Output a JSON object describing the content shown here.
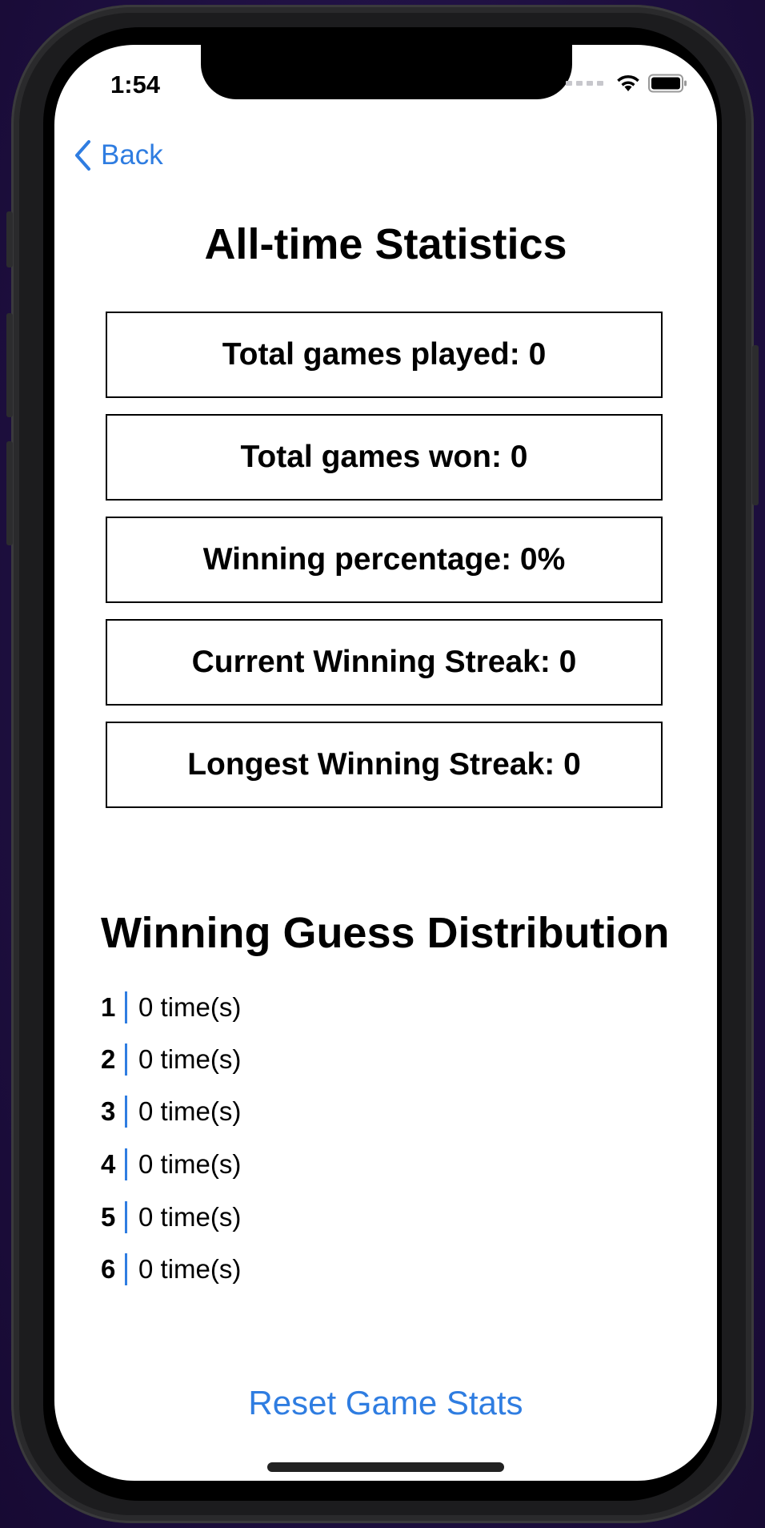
{
  "status_bar": {
    "time": "1:54"
  },
  "nav": {
    "back_label": "Back"
  },
  "title": "All-time Statistics",
  "stats": [
    {
      "label": "Total games played: 0"
    },
    {
      "label": "Total games won: 0"
    },
    {
      "label": "Winning percentage: 0%"
    },
    {
      "label": "Current Winning Streak: 0"
    },
    {
      "label": "Longest Winning Streak: 0"
    }
  ],
  "distribution": {
    "title": "Winning Guess Distribution",
    "rows": [
      {
        "guess": "1",
        "count": "0 time(s)"
      },
      {
        "guess": "2",
        "count": "0 time(s)"
      },
      {
        "guess": "3",
        "count": "0 time(s)"
      },
      {
        "guess": "4",
        "count": "0 time(s)"
      },
      {
        "guess": "5",
        "count": "0 time(s)"
      },
      {
        "guess": "6",
        "count": "0 time(s)"
      }
    ]
  },
  "reset_label": "Reset Game Stats",
  "colors": {
    "accent": "#2f7de1",
    "background": "#ffffff",
    "text": "#000000"
  }
}
